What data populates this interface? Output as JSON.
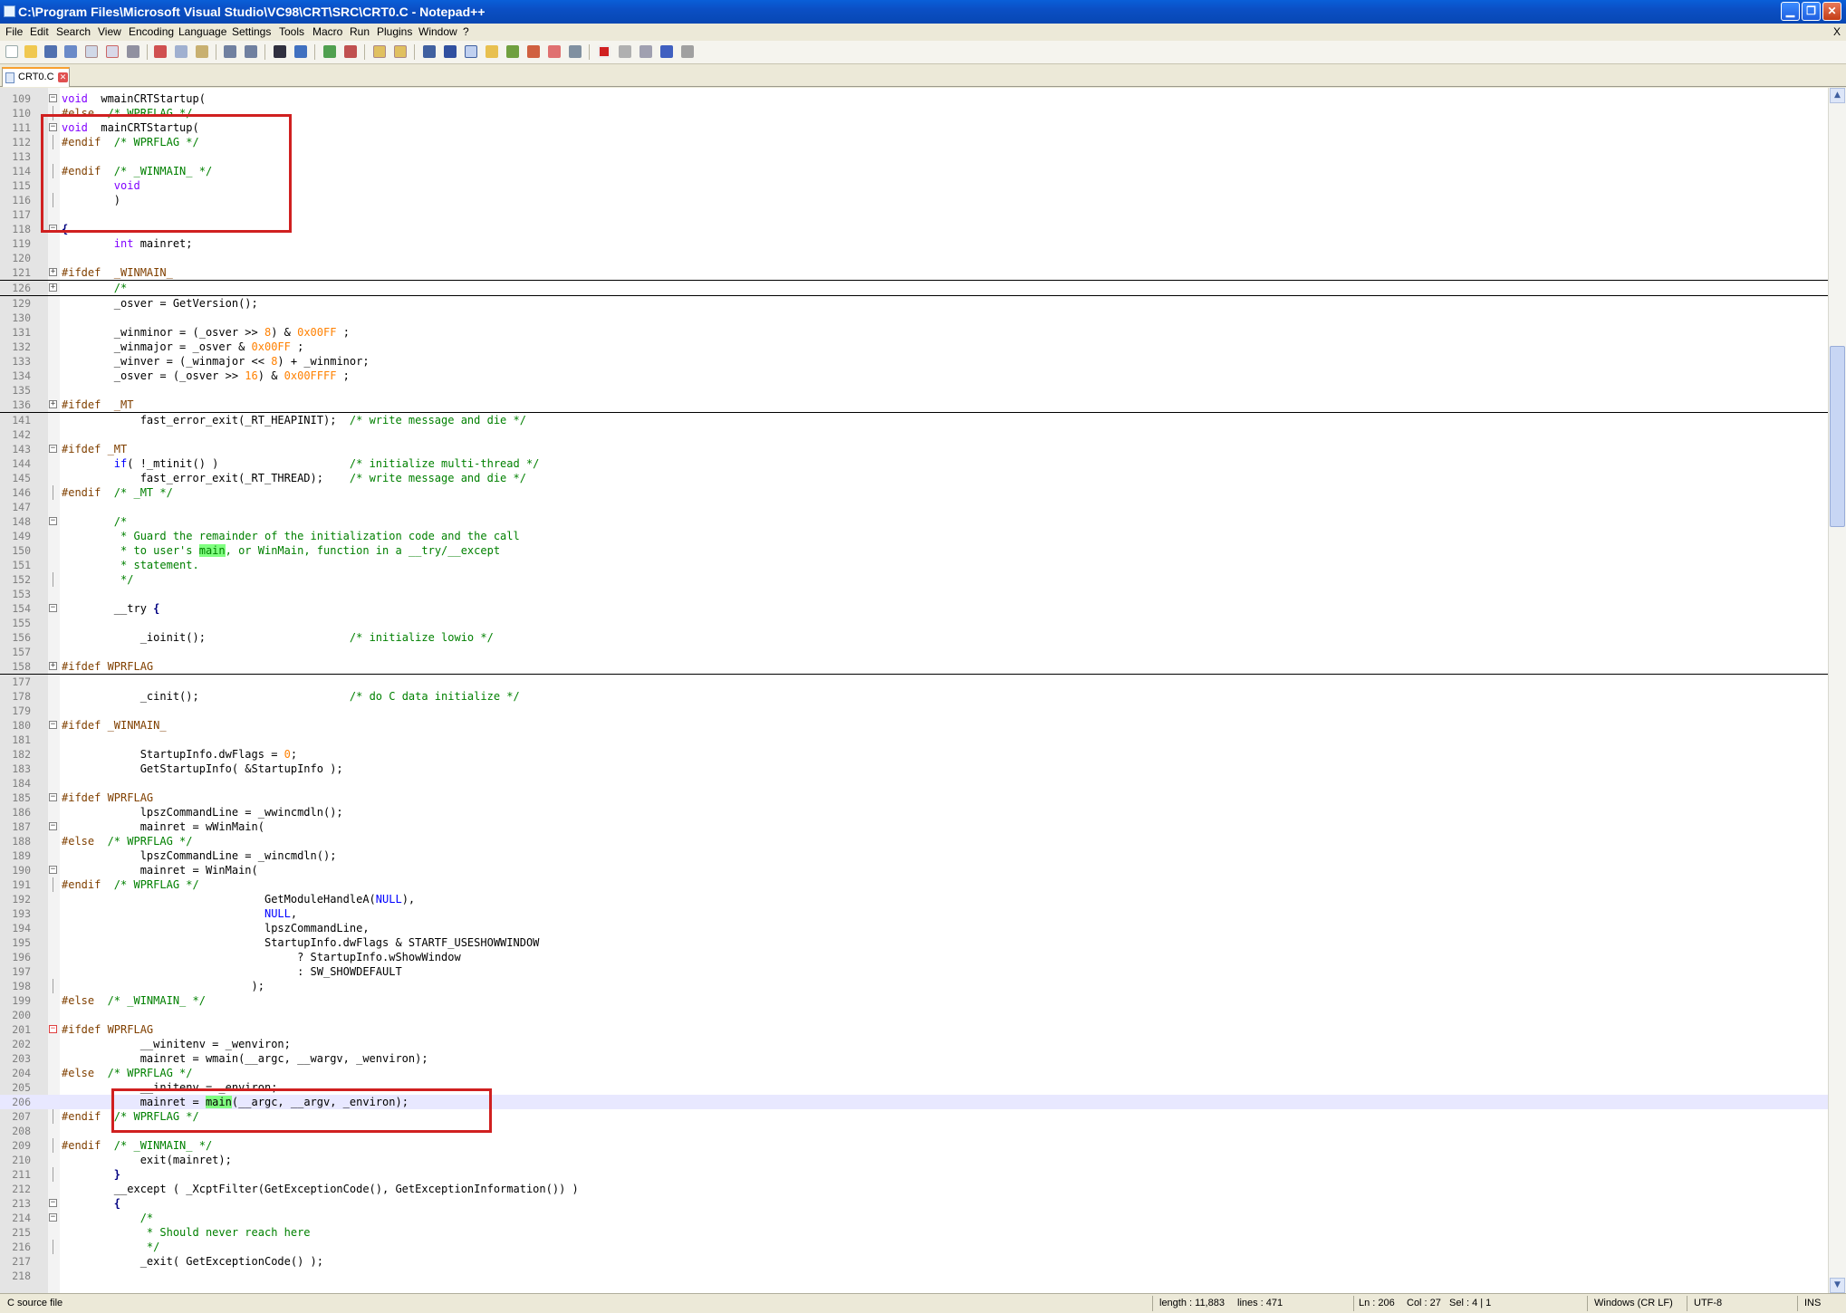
{
  "window": {
    "title": "C:\\Program Files\\Microsoft Visual Studio\\VC98\\CRT\\SRC\\CRT0.C - Notepad++"
  },
  "menu": {
    "items": [
      "File",
      "Edit",
      "Search",
      "View",
      "Encoding",
      "Language",
      "Settings",
      "Tools",
      "Macro",
      "Run",
      "Plugins",
      "Window",
      "?"
    ],
    "close_label": "X"
  },
  "tab": {
    "label": "CRT0.C"
  },
  "colors": {
    "keyword": "#0000ff",
    "type": "#8000ff",
    "preprocessor": "#804000",
    "comment": "#008000",
    "number": "#ff8000",
    "highlight": "#80ff80",
    "annotation": "#d02020"
  },
  "code": [
    {
      "n": "109",
      "fold": "box",
      "parts": [
        [
          "typ",
          "void"
        ],
        [
          "",
          "  wmainCRTStartup("
        ]
      ]
    },
    {
      "n": "110",
      "fold": "tick",
      "parts": [
        [
          "pp",
          "#else"
        ],
        [
          "cm",
          "  /* WPRFLAG */"
        ]
      ]
    },
    {
      "n": "111",
      "fold": "box",
      "parts": [
        [
          "typ",
          "void"
        ],
        [
          "",
          "  mainCRTStartup("
        ]
      ]
    },
    {
      "n": "112",
      "fold": "tick",
      "parts": [
        [
          "pp",
          "#endif"
        ],
        [
          "cm",
          "  /* WPRFLAG */"
        ]
      ]
    },
    {
      "n": "113",
      "fold": "",
      "parts": []
    },
    {
      "n": "114",
      "fold": "tick",
      "parts": [
        [
          "pp",
          "#endif"
        ],
        [
          "cm",
          "  /* _WINMAIN_ */"
        ]
      ]
    },
    {
      "n": "115",
      "fold": "",
      "parts": [
        [
          "",
          "        "
        ],
        [
          "typ",
          "void"
        ]
      ]
    },
    {
      "n": "116",
      "fold": "tick",
      "parts": [
        [
          "",
          "        )"
        ]
      ]
    },
    {
      "n": "117",
      "fold": "",
      "parts": []
    },
    {
      "n": "118",
      "fold": "box",
      "parts": [
        [
          "op",
          "{"
        ]
      ]
    },
    {
      "n": "119",
      "fold": "",
      "parts": [
        [
          "",
          "        "
        ],
        [
          "typ",
          "int"
        ],
        [
          "",
          " mainret;"
        ]
      ]
    },
    {
      "n": "120",
      "fold": "",
      "parts": []
    },
    {
      "n": "121",
      "fold": "box",
      "folded": true,
      "parts": [
        [
          "pp",
          "#ifdef  _WINMAIN_"
        ]
      ]
    },
    {
      "n": "126",
      "fold": "box",
      "folded": true,
      "parts": [
        [
          "cm",
          "        /*"
        ]
      ]
    },
    {
      "n": "129",
      "fold": "",
      "parts": [
        [
          "",
          "        _osver = GetVersion();"
        ]
      ]
    },
    {
      "n": "130",
      "fold": "",
      "parts": []
    },
    {
      "n": "131",
      "fold": "",
      "parts": [
        [
          "",
          "        _winminor = (_osver >> "
        ],
        [
          "nm",
          "8"
        ],
        [
          "",
          ") & "
        ],
        [
          "nm",
          "0x00FF"
        ],
        [
          "",
          " ;"
        ]
      ]
    },
    {
      "n": "132",
      "fold": "",
      "parts": [
        [
          "",
          "        _winmajor = _osver & "
        ],
        [
          "nm",
          "0x00FF"
        ],
        [
          "",
          " ;"
        ]
      ]
    },
    {
      "n": "133",
      "fold": "",
      "parts": [
        [
          "",
          "        _winver = (_winmajor << "
        ],
        [
          "nm",
          "8"
        ],
        [
          "",
          ") + _winminor;"
        ]
      ]
    },
    {
      "n": "134",
      "fold": "",
      "parts": [
        [
          "",
          "        _osver = (_osver >> "
        ],
        [
          "nm",
          "16"
        ],
        [
          "",
          ") & "
        ],
        [
          "nm",
          "0x00FFFF"
        ],
        [
          "",
          " ;"
        ]
      ]
    },
    {
      "n": "135",
      "fold": "",
      "parts": []
    },
    {
      "n": "136",
      "fold": "box",
      "folded": true,
      "parts": [
        [
          "pp",
          "#ifdef  _MT"
        ]
      ]
    },
    {
      "n": "141",
      "fold": "",
      "parts": [
        [
          "",
          "            fast_error_exit(_RT_HEAPINIT);  "
        ],
        [
          "cm",
          "/* write message and die */"
        ]
      ]
    },
    {
      "n": "142",
      "fold": "",
      "parts": []
    },
    {
      "n": "143",
      "fold": "box",
      "parts": [
        [
          "pp",
          "#ifdef _MT"
        ]
      ]
    },
    {
      "n": "144",
      "fold": "",
      "parts": [
        [
          "",
          "        "
        ],
        [
          "kw",
          "if"
        ],
        [
          "",
          "( !_mtinit() )                    "
        ],
        [
          "cm",
          "/* initialize multi-thread */"
        ]
      ]
    },
    {
      "n": "145",
      "fold": "",
      "parts": [
        [
          "",
          "            fast_error_exit(_RT_THREAD);    "
        ],
        [
          "cm",
          "/* write message and die */"
        ]
      ]
    },
    {
      "n": "146",
      "fold": "tick",
      "parts": [
        [
          "pp",
          "#endif"
        ],
        [
          "cm",
          "  /* _MT */"
        ]
      ]
    },
    {
      "n": "147",
      "fold": "",
      "parts": []
    },
    {
      "n": "148",
      "fold": "box",
      "parts": [
        [
          "cm",
          "        /*"
        ]
      ]
    },
    {
      "n": "149",
      "fold": "",
      "parts": [
        [
          "cm",
          "         * Guard the remainder of the initialization code and the call"
        ]
      ]
    },
    {
      "n": "150",
      "fold": "",
      "parts": [
        [
          "cm",
          "         * to user's "
        ],
        [
          "cm hl",
          "main"
        ],
        [
          "cm",
          ", or WinMain, function in a __try/__except"
        ]
      ]
    },
    {
      "n": "151",
      "fold": "",
      "parts": [
        [
          "cm",
          "         * statement."
        ]
      ]
    },
    {
      "n": "152",
      "fold": "tick",
      "parts": [
        [
          "cm",
          "         */"
        ]
      ]
    },
    {
      "n": "153",
      "fold": "",
      "parts": []
    },
    {
      "n": "154",
      "fold": "box",
      "parts": [
        [
          "",
          "        __try "
        ],
        [
          "op",
          "{"
        ]
      ]
    },
    {
      "n": "155",
      "fold": "",
      "parts": []
    },
    {
      "n": "156",
      "fold": "",
      "parts": [
        [
          "",
          "            _ioinit();                      "
        ],
        [
          "cm",
          "/* initialize lowio */"
        ]
      ]
    },
    {
      "n": "157",
      "fold": "",
      "parts": []
    },
    {
      "n": "158",
      "fold": "box",
      "folded": true,
      "parts": [
        [
          "pp",
          "#ifdef WPRFLAG"
        ]
      ]
    },
    {
      "n": "177",
      "fold": "",
      "parts": []
    },
    {
      "n": "178",
      "fold": "",
      "parts": [
        [
          "",
          "            _cinit();                       "
        ],
        [
          "cm",
          "/* do C data initialize */"
        ]
      ]
    },
    {
      "n": "179",
      "fold": "",
      "parts": []
    },
    {
      "n": "180",
      "fold": "box",
      "parts": [
        [
          "pp",
          "#ifdef _WINMAIN_"
        ]
      ]
    },
    {
      "n": "181",
      "fold": "",
      "parts": []
    },
    {
      "n": "182",
      "fold": "",
      "parts": [
        [
          "",
          "            StartupInfo.dwFlags = "
        ],
        [
          "nm",
          "0"
        ],
        [
          "",
          ";"
        ]
      ]
    },
    {
      "n": "183",
      "fold": "",
      "parts": [
        [
          "",
          "            GetStartupInfo( &StartupInfo );"
        ]
      ]
    },
    {
      "n": "184",
      "fold": "",
      "parts": []
    },
    {
      "n": "185",
      "fold": "box",
      "parts": [
        [
          "pp",
          "#ifdef WPRFLAG"
        ]
      ]
    },
    {
      "n": "186",
      "fold": "",
      "parts": [
        [
          "",
          "            lpszCommandLine = _wwincmdln();"
        ]
      ]
    },
    {
      "n": "187",
      "fold": "box",
      "parts": [
        [
          "",
          "            mainret = wWinMain("
        ]
      ]
    },
    {
      "n": "188",
      "fold": "",
      "parts": [
        [
          "pp",
          "#else"
        ],
        [
          "cm",
          "  /* WPRFLAG */"
        ]
      ]
    },
    {
      "n": "189",
      "fold": "",
      "parts": [
        [
          "",
          "            lpszCommandLine = _wincmdln();"
        ]
      ]
    },
    {
      "n": "190",
      "fold": "box",
      "parts": [
        [
          "",
          "            mainret = WinMain("
        ]
      ]
    },
    {
      "n": "191",
      "fold": "tick",
      "parts": [
        [
          "pp",
          "#endif"
        ],
        [
          "cm",
          "  /* WPRFLAG */"
        ]
      ]
    },
    {
      "n": "192",
      "fold": "",
      "parts": [
        [
          "",
          "                               GetModuleHandleA("
        ],
        [
          "kw",
          "NULL"
        ],
        [
          "",
          "),"
        ]
      ]
    },
    {
      "n": "193",
      "fold": "",
      "parts": [
        [
          "",
          "                               "
        ],
        [
          "kw",
          "NULL"
        ],
        [
          "",
          ","
        ]
      ]
    },
    {
      "n": "194",
      "fold": "",
      "parts": [
        [
          "",
          "                               lpszCommandLine,"
        ]
      ]
    },
    {
      "n": "195",
      "fold": "",
      "parts": [
        [
          "",
          "                               StartupInfo.dwFlags & STARTF_USESHOWWINDOW"
        ]
      ]
    },
    {
      "n": "196",
      "fold": "",
      "parts": [
        [
          "",
          "                                    ? StartupInfo.wShowWindow"
        ]
      ]
    },
    {
      "n": "197",
      "fold": "",
      "parts": [
        [
          "",
          "                                    : SW_SHOWDEFAULT"
        ]
      ]
    },
    {
      "n": "198",
      "fold": "tick",
      "parts": [
        [
          "",
          "                             );"
        ]
      ]
    },
    {
      "n": "199",
      "fold": "",
      "parts": [
        [
          "pp",
          "#else"
        ],
        [
          "cm",
          "  /* _WINMAIN_ */"
        ]
      ]
    },
    {
      "n": "200",
      "fold": "",
      "parts": []
    },
    {
      "n": "201",
      "fold": "red",
      "parts": [
        [
          "pp",
          "#ifdef WPRFLAG"
        ]
      ]
    },
    {
      "n": "202",
      "fold": "",
      "parts": [
        [
          "",
          "            __winitenv = _wenviron;"
        ]
      ]
    },
    {
      "n": "203",
      "fold": "",
      "parts": [
        [
          "",
          "            mainret = wmain(__argc, __wargv, _wenviron);"
        ]
      ]
    },
    {
      "n": "204",
      "fold": "",
      "parts": [
        [
          "pp",
          "#else"
        ],
        [
          "cm",
          "  /* WPRFLAG */"
        ]
      ]
    },
    {
      "n": "205",
      "fold": "",
      "parts": [
        [
          "",
          "            __initenv = _environ;"
        ]
      ]
    },
    {
      "n": "206",
      "fold": "",
      "current": true,
      "parts": [
        [
          "",
          "            mainret = "
        ],
        [
          "hl",
          "main"
        ],
        [
          "",
          "(__argc, __argv, _environ);"
        ]
      ]
    },
    {
      "n": "207",
      "fold": "tick",
      "parts": [
        [
          "pp",
          "#endif"
        ],
        [
          "cm",
          "  /* WPRFLAG */"
        ]
      ]
    },
    {
      "n": "208",
      "fold": "",
      "parts": []
    },
    {
      "n": "209",
      "fold": "tick",
      "parts": [
        [
          "pp",
          "#endif"
        ],
        [
          "cm",
          "  /* _WINMAIN_ */"
        ]
      ]
    },
    {
      "n": "210",
      "fold": "",
      "parts": [
        [
          "",
          "            exit(mainret);"
        ]
      ]
    },
    {
      "n": "211",
      "fold": "tick",
      "parts": [
        [
          "",
          "        "
        ],
        [
          "op",
          "}"
        ]
      ]
    },
    {
      "n": "212",
      "fold": "",
      "parts": [
        [
          "",
          "        __except ( _XcptFilter(GetExceptionCode(), GetExceptionInformation()) )"
        ]
      ]
    },
    {
      "n": "213",
      "fold": "box",
      "parts": [
        [
          "",
          "        "
        ],
        [
          "op",
          "{"
        ]
      ]
    },
    {
      "n": "214",
      "fold": "box",
      "parts": [
        [
          "cm",
          "            /*"
        ]
      ]
    },
    {
      "n": "215",
      "fold": "",
      "parts": [
        [
          "cm",
          "             * Should never reach here"
        ]
      ]
    },
    {
      "n": "216",
      "fold": "tick",
      "parts": [
        [
          "cm",
          "             */"
        ]
      ]
    },
    {
      "n": "217",
      "fold": "",
      "parts": [
        [
          "",
          "            _exit( GetExceptionCode() );"
        ]
      ]
    },
    {
      "n": "218",
      "fold": "",
      "parts": []
    }
  ],
  "status": {
    "file_type": "C source file",
    "length": "length : 11,883",
    "lines": "lines : 471",
    "ln": "Ln : 206",
    "col": "Col : 27",
    "sel": "Sel : 4 | 1",
    "eol": "Windows (CR LF)",
    "encoding": "UTF-8",
    "mode": "INS"
  }
}
